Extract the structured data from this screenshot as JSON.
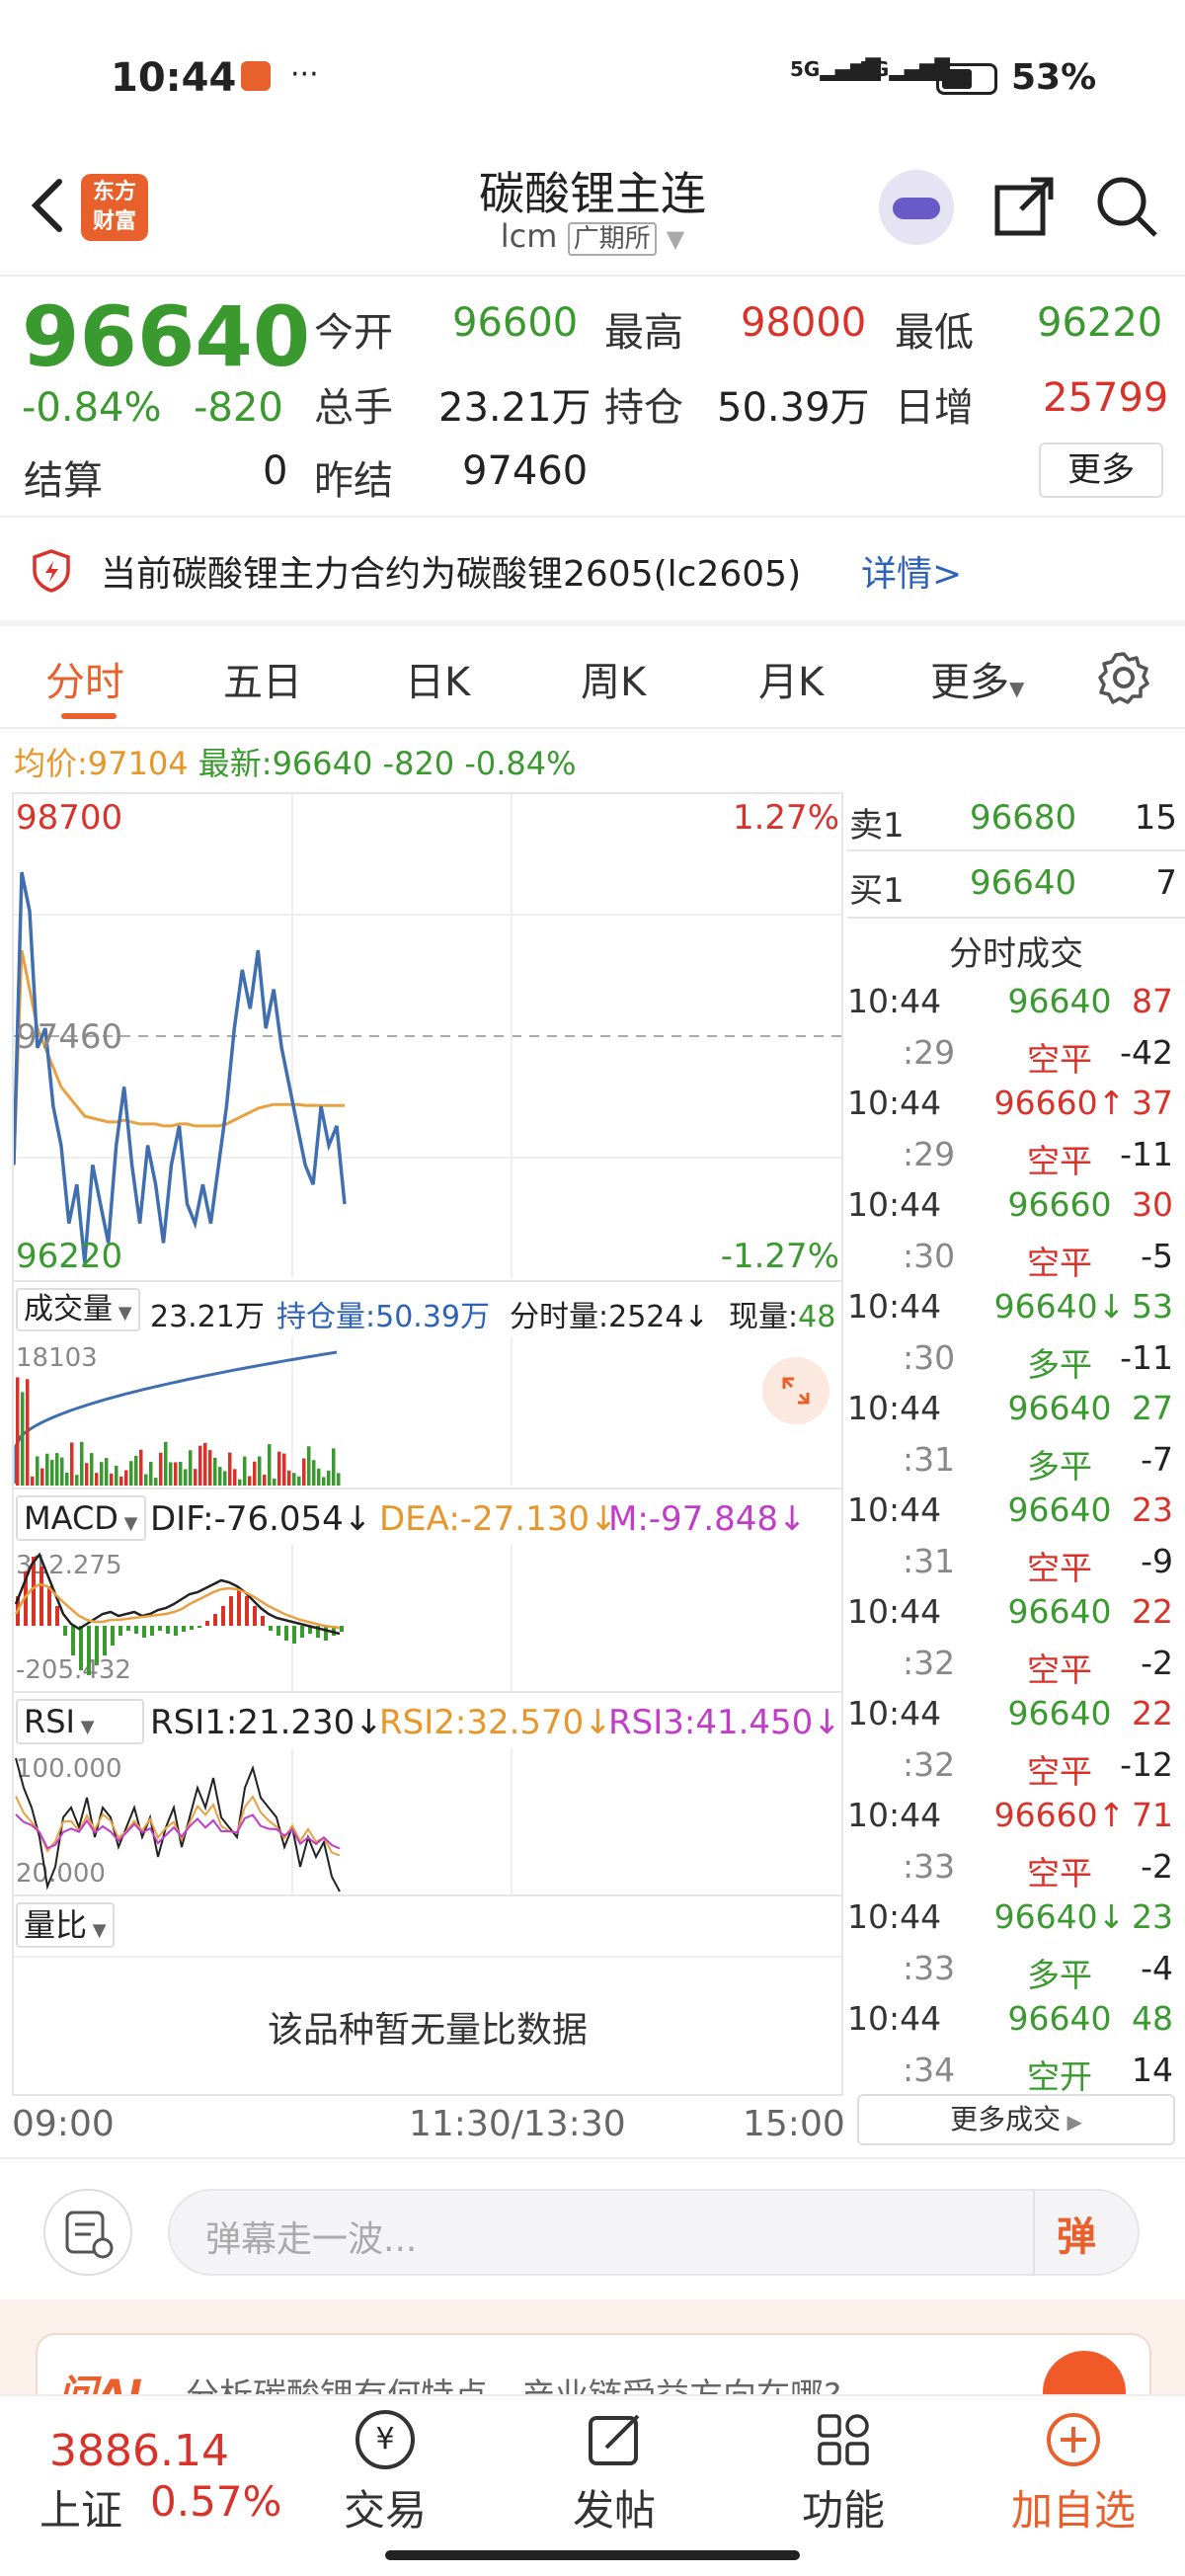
{
  "status_bar": {
    "time": "10:44",
    "battery": "53%",
    "network1": "5G",
    "network2": "5G"
  },
  "header": {
    "title": "碳酸锂主连",
    "code": "lcm",
    "exchange": "广期所",
    "app_logo_line1": "东方",
    "app_logo_line2": "财富"
  },
  "quote": {
    "last": "96640",
    "change_pct": "-0.84%",
    "change": "-820",
    "open_label": "今开",
    "open": "96600",
    "high_label": "最高",
    "high": "98000",
    "low_label": "最低",
    "low": "96220",
    "volume_label": "总手",
    "volume": "23.21万",
    "oi_label": "持仓",
    "oi": "50.39万",
    "oi_change_label": "日增",
    "oi_change": "25799",
    "settle_label": "结算",
    "settle": "0",
    "prev_settle_label": "昨结",
    "prev_settle": "97460",
    "more_button": "更多"
  },
  "notice": {
    "text": "当前碳酸锂主力合约为碳酸锂2605(lc2605)",
    "link": "详情>"
  },
  "tabs": [
    "分时",
    "五日",
    "日K",
    "周K",
    "月K",
    "更多"
  ],
  "summary": {
    "avg_label": "均价:",
    "avg": "97104",
    "latest_label": "最新:",
    "latest": "96640",
    "chg": "-820",
    "chg_pct": "-0.84%"
  },
  "chart_data": {
    "type": "line",
    "y_max": "98700",
    "y_mid": "97460",
    "y_min": "96220",
    "pct_max": "1.27%",
    "pct_min": "-1.27%",
    "ylim": [
      96220,
      98700
    ],
    "x_labels": [
      "09:00",
      "11:30/13:30",
      "15:00"
    ],
    "price": [
      96800,
      98300,
      98100,
      97400,
      97500,
      97100,
      96900,
      96500,
      96700,
      96300,
      96800,
      96600,
      96400,
      96900,
      97200,
      96800,
      96500,
      96900,
      96700,
      96400,
      96800,
      97000,
      96600,
      96500,
      96700,
      96500,
      96800,
      97100,
      97500,
      97800,
      97600,
      97900,
      97500,
      97700,
      97400,
      97200,
      97000,
      96800,
      96700,
      97100,
      96900,
      97000,
      96600
    ],
    "avg_price": [
      96800,
      97900,
      97700,
      97500,
      97400,
      97300,
      97200,
      97150,
      97100,
      97050,
      97040,
      97030,
      97020,
      97020,
      97030,
      97020,
      97010,
      97010,
      97010,
      97000,
      97000,
      97010,
      97010,
      97000,
      97000,
      97000,
      97000,
      97010,
      97030,
      97050,
      97070,
      97090,
      97100,
      97110,
      97110,
      97110,
      97110,
      97105,
      97105,
      97104,
      97104,
      97104,
      97104
    ]
  },
  "volume_panel": {
    "selector": "成交量",
    "total": "23.21万",
    "oi_text": "持仓量:50.39万",
    "tick_vol": "分时量:2524↓",
    "now_label": "现量:",
    "now_vol": "48",
    "axis_max": "18103"
  },
  "macd_panel": {
    "selector": "MACD",
    "dif": "DIF:-76.054↓",
    "dea": "DEA:-27.130↓",
    "m": "M:-97.848↓",
    "axis_top": "312.275",
    "axis_bottom": "-205.432"
  },
  "rsi_panel": {
    "selector": "RSI",
    "rsi1": "RSI1:21.230↓",
    "rsi2": "RSI2:32.570↓",
    "rsi3": "RSI3:41.450↓",
    "axis_top": "100.000",
    "axis_bottom": "20.000"
  },
  "ratio_panel": {
    "selector": "量比",
    "empty_text": "该品种暂无量比数据"
  },
  "orderbook": {
    "ask_label": "卖1",
    "ask_price": "96680",
    "ask_vol": "15",
    "bid_label": "买1",
    "bid_price": "96640",
    "bid_vol": "7",
    "trades_title": "分时成交",
    "more_trades": "更多成交"
  },
  "trades": [
    {
      "t": "10:44",
      "p": "96640",
      "pc": "green",
      "v": "87",
      "vc": "red"
    },
    {
      "t": ":29",
      "p": "空平",
      "pc": "red",
      "v": "-42",
      "vc": "dark"
    },
    {
      "t": "10:44",
      "p": "96660↑",
      "pc": "red",
      "v": "37",
      "vc": "red"
    },
    {
      "t": ":29",
      "p": "空平",
      "pc": "red",
      "v": "-11",
      "vc": "dark"
    },
    {
      "t": "10:44",
      "p": "96660",
      "pc": "green",
      "v": "30",
      "vc": "red"
    },
    {
      "t": ":30",
      "p": "空平",
      "pc": "red",
      "v": "-5",
      "vc": "dark"
    },
    {
      "t": "10:44",
      "p": "96640↓",
      "pc": "green",
      "v": "53",
      "vc": "green"
    },
    {
      "t": ":30",
      "p": "多平",
      "pc": "green",
      "v": "-11",
      "vc": "dark"
    },
    {
      "t": "10:44",
      "p": "96640",
      "pc": "green",
      "v": "27",
      "vc": "green"
    },
    {
      "t": ":31",
      "p": "多平",
      "pc": "green",
      "v": "-7",
      "vc": "dark"
    },
    {
      "t": "10:44",
      "p": "96640",
      "pc": "green",
      "v": "23",
      "vc": "red"
    },
    {
      "t": ":31",
      "p": "空平",
      "pc": "red",
      "v": "-9",
      "vc": "dark"
    },
    {
      "t": "10:44",
      "p": "96640",
      "pc": "green",
      "v": "22",
      "vc": "red"
    },
    {
      "t": ":32",
      "p": "空平",
      "pc": "red",
      "v": "-2",
      "vc": "dark"
    },
    {
      "t": "10:44",
      "p": "96640",
      "pc": "green",
      "v": "22",
      "vc": "red"
    },
    {
      "t": ":32",
      "p": "空平",
      "pc": "red",
      "v": "-12",
      "vc": "dark"
    },
    {
      "t": "10:44",
      "p": "96660↑",
      "pc": "red",
      "v": "71",
      "vc": "red"
    },
    {
      "t": ":33",
      "p": "空平",
      "pc": "red",
      "v": "-2",
      "vc": "dark"
    },
    {
      "t": "10:44",
      "p": "96640↓",
      "pc": "green",
      "v": "23",
      "vc": "green"
    },
    {
      "t": ":33",
      "p": "多平",
      "pc": "green",
      "v": "-4",
      "vc": "dark"
    },
    {
      "t": "10:44",
      "p": "96640",
      "pc": "green",
      "v": "48",
      "vc": "green"
    },
    {
      "t": ":34",
      "p": "空开",
      "pc": "green",
      "v": "14",
      "vc": "dark"
    }
  ],
  "comment_bar": {
    "placeholder": "弹幕走一波...",
    "danmu_label": "弹"
  },
  "ai_banner": {
    "logo": "问AI",
    "text": "分析碳酸锂有何特点，产业链受益方向在哪?"
  },
  "bottom_bar": {
    "index_value": "3886.14",
    "index_name": "上证",
    "index_pct": "0.57%",
    "items": [
      "交易",
      "发帖",
      "功能",
      "加自选"
    ]
  },
  "colors": {
    "accent": "#e8602c",
    "up": "#d9322a",
    "down": "#3a9a2f",
    "link": "#2e62b8"
  }
}
